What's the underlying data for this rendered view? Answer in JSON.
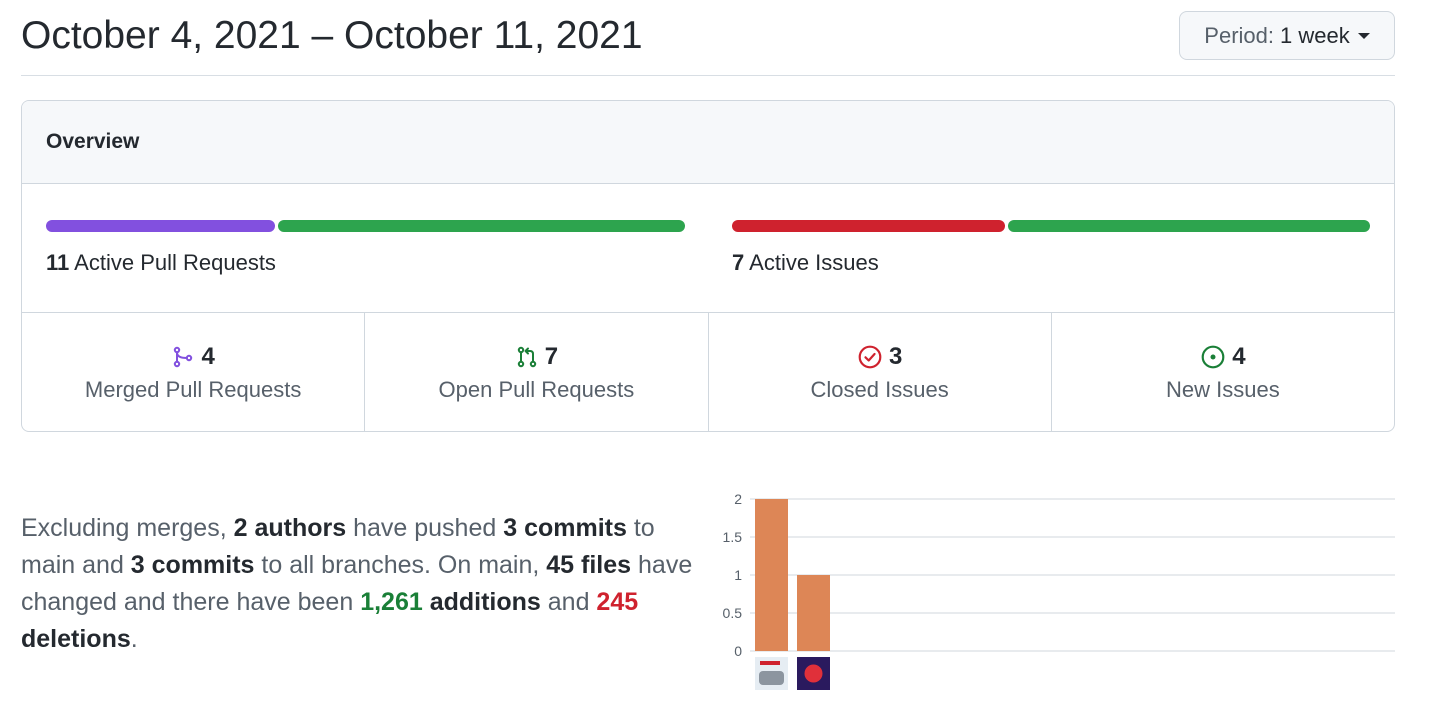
{
  "header": {
    "date_range": "October 4, 2021 – October 11, 2021",
    "period_label": "Period:",
    "period_value": "1 week"
  },
  "overview": {
    "title": "Overview",
    "pull_requests": {
      "count": "11",
      "label": "Active Pull Requests",
      "merged_fraction": 0.36,
      "colors": {
        "merged": "#8250df",
        "open": "#2da44e"
      }
    },
    "issues": {
      "count": "7",
      "label": "Active Issues",
      "closed_fraction": 0.43,
      "colors": {
        "closed": "#cf222e",
        "new": "#2da44e"
      }
    },
    "stats": [
      {
        "icon": "git-merge-icon",
        "count": "4",
        "label": "Merged Pull Requests",
        "color": "#8250df"
      },
      {
        "icon": "git-pull-request-icon",
        "count": "7",
        "label": "Open Pull Requests",
        "color": "#1a7f37"
      },
      {
        "icon": "issue-closed-icon",
        "count": "3",
        "label": "Closed Issues",
        "color": "#cf222e"
      },
      {
        "icon": "issue-opened-icon",
        "count": "4",
        "label": "New Issues",
        "color": "#1a7f37"
      }
    ]
  },
  "summary": {
    "t1": "Excluding merges, ",
    "authors": "2 authors",
    "t2": " have pushed ",
    "commits_main": "3 commits",
    "t3": " to main and ",
    "commits_all": "3 commits",
    "t4": " to all branches. On main, ",
    "files": "45 files",
    "t5": " have changed and there have been ",
    "additions_num": "1,261",
    "additions_word": " additions",
    "t6": " and ",
    "deletions_num": "245",
    "deletions_word": " deletions",
    "t7": "."
  },
  "chart_data": {
    "type": "bar",
    "categories": [
      "author-1",
      "author-2"
    ],
    "values": [
      2,
      1
    ],
    "ylim": [
      0,
      2
    ],
    "yticks": [
      "0",
      "0.5",
      "1",
      "1.5",
      "2"
    ],
    "bar_color": "#dd8656",
    "grid": true,
    "xlabel": "",
    "ylabel": ""
  }
}
